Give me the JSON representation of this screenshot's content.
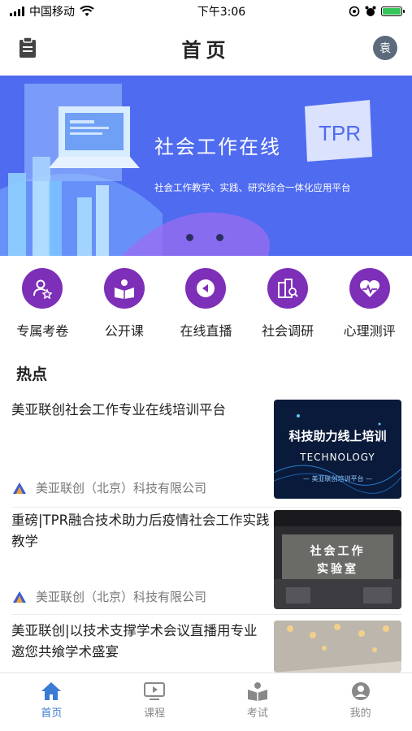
{
  "status_bar": {
    "carrier": "中国移动",
    "time": "下午3:06"
  },
  "header": {
    "title": "首页",
    "avatar_text": "袁"
  },
  "banner": {
    "title": "社会工作在线",
    "subtitle": "社会工作教学、实践、研究综合一体化应用平台",
    "logo_text": "TPR"
  },
  "quick_links": [
    {
      "label": "专属考卷",
      "icon": "person-star-icon"
    },
    {
      "label": "公开课",
      "icon": "reading-icon"
    },
    {
      "label": "在线直播",
      "icon": "play-icon"
    },
    {
      "label": "社会调研",
      "icon": "buildings-search-icon"
    },
    {
      "label": "心理测评",
      "icon": "heart-pulse-icon"
    }
  ],
  "hot_section": {
    "title": "热点"
  },
  "news": [
    {
      "title": "美亚联创社会工作专业在线培训平台",
      "source": "美亚联创（北京）科技有限公司",
      "thumb_text_1": "科技助力线上培训",
      "thumb_text_2": "TECHNOLOGY",
      "thumb_text_3": "— 美亚联创培训平台 —"
    },
    {
      "title": "重磅|TPR融合技术助力后疫情社会工作实践教学",
      "source": "美亚联创（北京）科技有限公司",
      "thumb_text_1": "社会工作",
      "thumb_text_2": "实验室"
    },
    {
      "title": "美亚联创|以技术支撑学术会议直播用专业邀您共飨学术盛宴"
    }
  ],
  "tabbar": [
    {
      "label": "首页",
      "icon": "home-icon",
      "active": true
    },
    {
      "label": "课程",
      "icon": "video-icon",
      "active": false
    },
    {
      "label": "考试",
      "icon": "book-icon",
      "active": false
    },
    {
      "label": "我的",
      "icon": "user-icon",
      "active": false
    }
  ],
  "colors": {
    "banner": "#4f6bef",
    "accent_purple": "#7d2fb8",
    "active_tab": "#3a7bd5"
  }
}
